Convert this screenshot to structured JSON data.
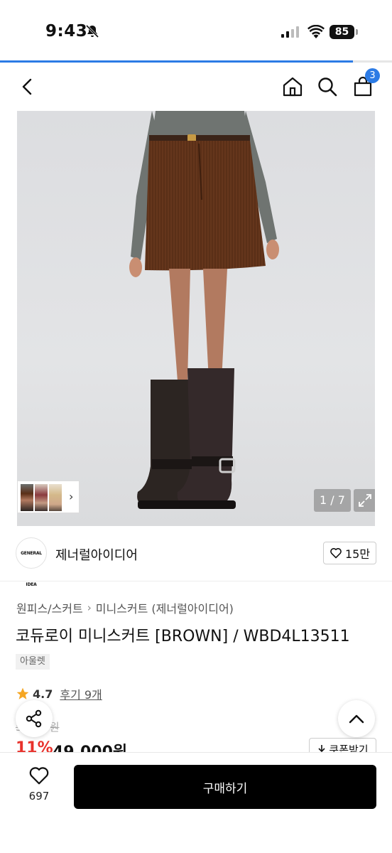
{
  "status_bar": {
    "time": "9:43",
    "battery": "85"
  },
  "page_progress": 0.9,
  "nav": {
    "cart_count": "3"
  },
  "gallery": {
    "page_indicator": "1 / 7"
  },
  "brand": {
    "logo_text": "GENERAL IDEA",
    "name": "제너럴아이디어",
    "likes": "15만"
  },
  "breadcrumb": {
    "category": "원피스/스커트",
    "subcategory": "미니스커트 (제너럴아이디어)"
  },
  "product": {
    "title": "코듀로이 미니스커트 [BROWN] / WBD4L13511",
    "badge": "아울렛",
    "rating": "4.7",
    "reviews": "후기 9개",
    "original_price": "55,0 9원",
    "discount": "11%",
    "price": "49,000원"
  },
  "actions": {
    "coupon": "쿠폰받기",
    "wish_count": "697",
    "buy": "구매하기"
  },
  "colors": {
    "accent": "#2c7be5",
    "discount": "#e8322c",
    "star": "#f5a623"
  }
}
